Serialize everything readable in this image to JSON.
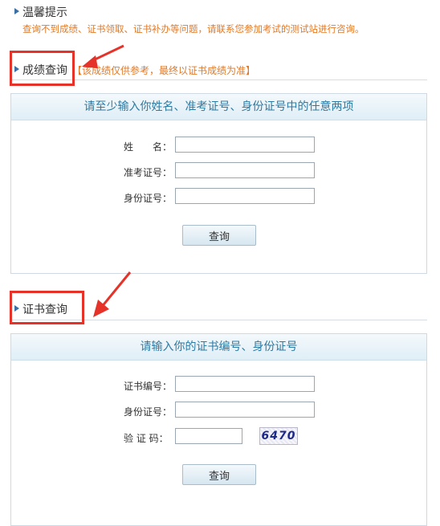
{
  "tips": {
    "title": "温馨提示",
    "text": "查询不到成绩、证书领取、证书补办等问题，请联系您参加考试的测试站进行咨询。"
  },
  "score_section": {
    "title": "成绩查询",
    "note": "【该成绩仅供参考，最终以证书成绩为准】",
    "panel_title": "请至少输入你姓名、准考证号、身份证号中的任意两项",
    "fields": {
      "name_label": "姓　　名：",
      "ticket_label": "准考证号：",
      "id_label": "身份证号："
    },
    "button_label": "查询"
  },
  "cert_section": {
    "title": "证书查询",
    "panel_title": "请输入你的证书编号、身份证号",
    "fields": {
      "cert_label": "证书编号：",
      "id_label": "身份证号：",
      "captcha_label": "验 证 码："
    },
    "captcha_text": "6470",
    "button_label": "查询"
  },
  "colors": {
    "highlight_box": "#e5332a",
    "note_text": "#e07a2a",
    "panel_title_text": "#2d7aa3"
  }
}
